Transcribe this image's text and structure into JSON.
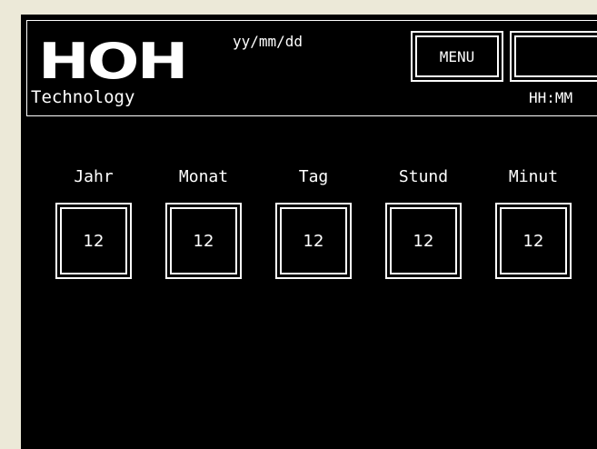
{
  "header": {
    "logo_text": "HOH",
    "logo_subtitle": "Technology",
    "date_format": "yy/mm/dd",
    "time_format": "HH:MM",
    "menu_label": "MENU",
    "blank_label": ""
  },
  "fields": [
    {
      "label": "Jahr",
      "value": "12"
    },
    {
      "label": "Monat",
      "value": "12"
    },
    {
      "label": "Tag",
      "value": "12"
    },
    {
      "label": "Stund",
      "value": "12"
    },
    {
      "label": "Minut",
      "value": "12"
    }
  ],
  "colors": {
    "screen_background": "#000000",
    "foreground": "#ffffff",
    "window_background": "#ece9d8"
  }
}
